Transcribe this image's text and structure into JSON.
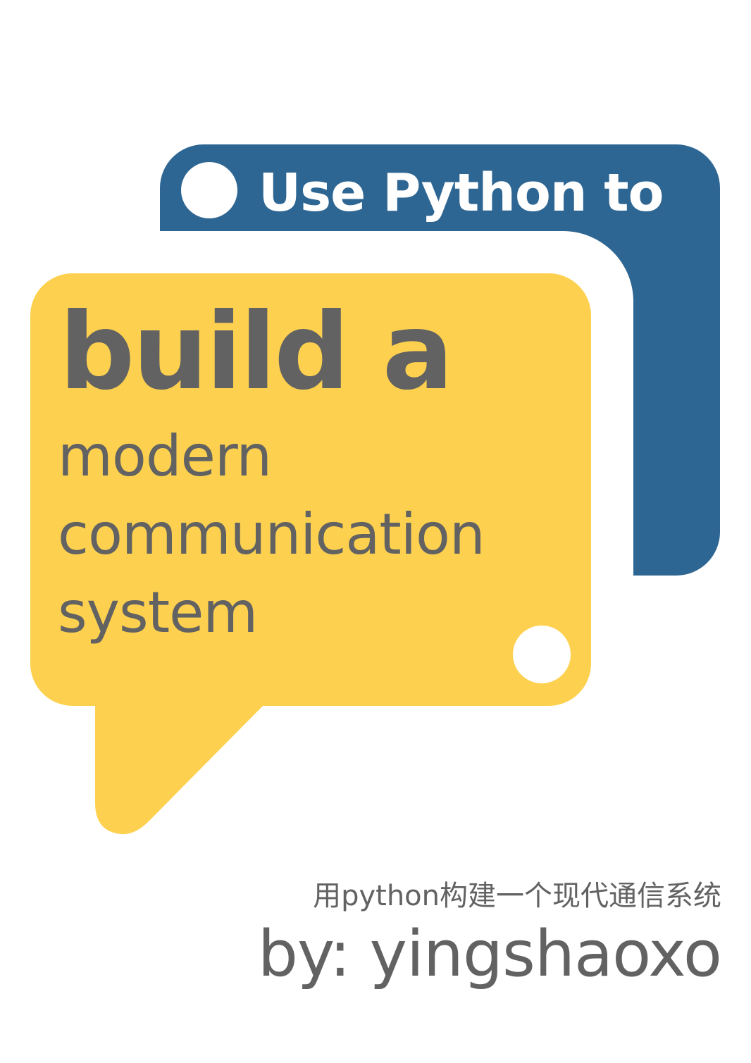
{
  "colors": {
    "background": "#ffffff",
    "blue_bubble": "#2e6693",
    "yellow_bubble": "#fdd14f",
    "text_dark": "#626262",
    "text_light": "#ffffff"
  },
  "blue_bubble": {
    "text": "Use Python to"
  },
  "yellow_bubble": {
    "headline": "build a",
    "lines": [
      "modern",
      "communication",
      "system"
    ]
  },
  "footer": {
    "subtitle_cn": "用python构建一个现代通信系统",
    "author": "by: yingshaoxo"
  }
}
